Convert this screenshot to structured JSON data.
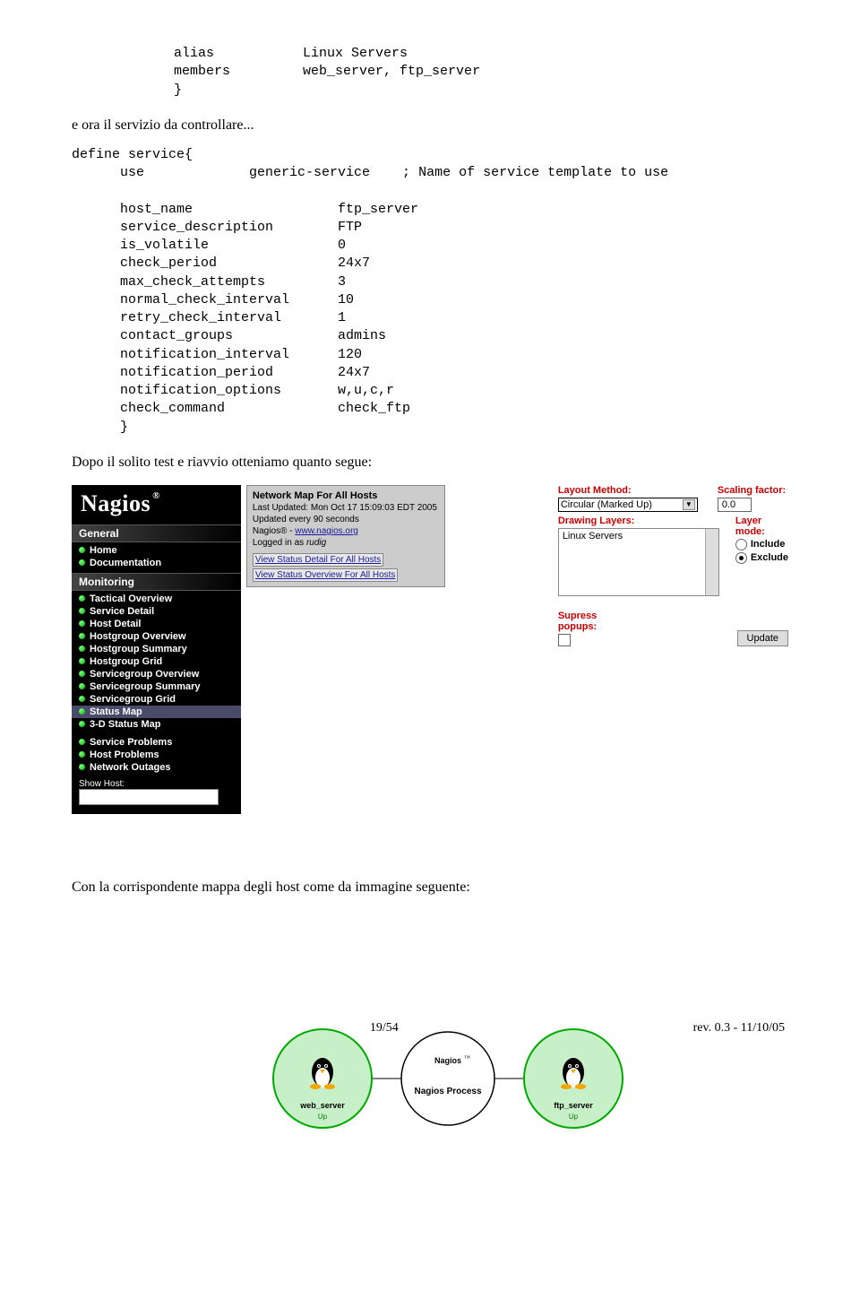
{
  "code_block_1": "      alias           Linux Servers\n      members         web_server, ftp_server\n      }",
  "narrative_1": "e ora il servizio da controllare...",
  "code_block_2": "define service{\n      use             generic-service    ; Name of service template to use\n\n      host_name                  ftp_server\n      service_description        FTP\n      is_volatile                0\n      check_period               24x7\n      max_check_attempts         3\n      normal_check_interval      10\n      retry_check_interval       1\n      contact_groups             admins\n      notification_interval      120\n      notification_period        24x7\n      notification_options       w,u,c,r\n      check_command              check_ftp\n      }",
  "narrative_2": "Dopo il solito test e riavvio otteniamo quanto segue:",
  "nagios": {
    "logo": "Nagios",
    "sections": {
      "general": {
        "title": "General",
        "items": [
          "Home",
          "Documentation"
        ]
      },
      "monitoring": {
        "title": "Monitoring",
        "items": [
          "Tactical Overview",
          "Service Detail",
          "Host Detail",
          "Hostgroup Overview",
          "Hostgroup Summary",
          "Hostgroup Grid",
          "Servicegroup Overview",
          "Servicegroup Summary",
          "Servicegroup Grid",
          "Status Map",
          "3-D Status Map"
        ],
        "items2": [
          "Service Problems",
          "Host Problems",
          "Network Outages"
        ]
      },
      "showhost": "Show Host:"
    },
    "infobox": {
      "title": "Network Map For All Hosts",
      "updated": "Last Updated: Mon Oct 17 15:09:03 EDT 2005",
      "refresh": "Updated every 90 seconds",
      "product": "Nagios® - ",
      "product_link": "www.nagios.org",
      "login": "Logged in as rudig",
      "link1": "View Status Detail For All Hosts",
      "link2": "View Status Overview For All Hosts"
    },
    "controls": {
      "layout_label": "Layout Method:",
      "layout_value": "Circular (Marked Up)",
      "scaling_label": "Scaling factor:",
      "scaling_value": "0.0",
      "layers_label": "Drawing Layers:",
      "layers_value": "Linux Servers",
      "layermode_label": "Layer mode:",
      "include": "Include",
      "exclude": "Exclude",
      "suppress": "Supress popups:",
      "update": "Update"
    },
    "map": {
      "host1": "web_server",
      "host2": "ftp_server",
      "center_top": "Nagios",
      "center": "Nagios Process",
      "up": "Up"
    }
  },
  "narrative_3": "Con la corrispondente mappa degli host come da immagine seguente:",
  "footer": {
    "page": "19/54",
    "rev": "rev. 0.3 - 11/10/05"
  }
}
